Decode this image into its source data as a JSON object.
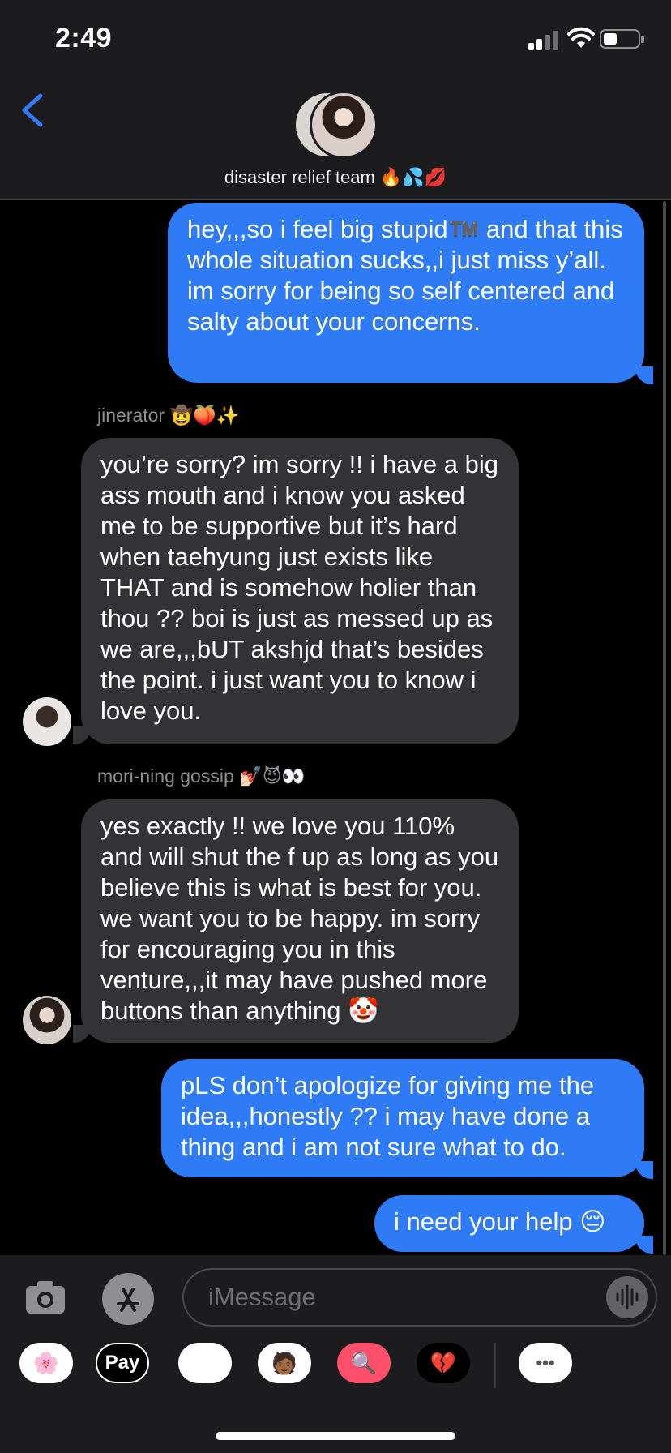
{
  "status_bar": {
    "time": "2:49"
  },
  "header": {
    "group_name": "disaster relief team 🔥💦💋"
  },
  "messages": [
    {
      "dir": "out",
      "text": "hey,,,so i feel big stupid™️ and that this whole situation sucks,,i just miss y’all. im sorry for being so self centered and salty about your concerns."
    },
    {
      "dir": "in",
      "sender": "jinerator 🤠🍑✨",
      "text": "you’re sorry? im sorry !! i have a big ass mouth and i know you asked me to be supportive but it’s hard when taehyung just exists like THAT and is somehow holier than thou ?? boi is just as messed up as we are,,,bUT akshjd that’s besides the point. i just want you to know i love you."
    },
    {
      "dir": "in",
      "sender": "mori-ning gossip 💅🏻😈👀",
      "text": "yes exactly !! we love you 110% and will shut the f up as long as you believe this is what is best for you. we want you to be happy. im sorry for encouraging you in this venture,,,it may have pushed more buttons than anything 🤡"
    },
    {
      "dir": "out",
      "text": "pLS don’t apologize for giving me the idea,,,honestly ?? i may have done a thing and i am not sure what to do."
    },
    {
      "dir": "out",
      "text": "i need your help 😔"
    }
  ],
  "input": {
    "placeholder": "iMessage"
  },
  "apps": {
    "photos": "🌸",
    "pay": "Pay",
    "memoji1": "🐵",
    "memoji2": "🧑🏾",
    "search": "🔍",
    "digital_touch": "💔",
    "more": "•••"
  },
  "colors": {
    "outgoing": "#2f7bf5",
    "incoming": "#333335",
    "background": "#000000",
    "bars": "#1c1c1e"
  }
}
